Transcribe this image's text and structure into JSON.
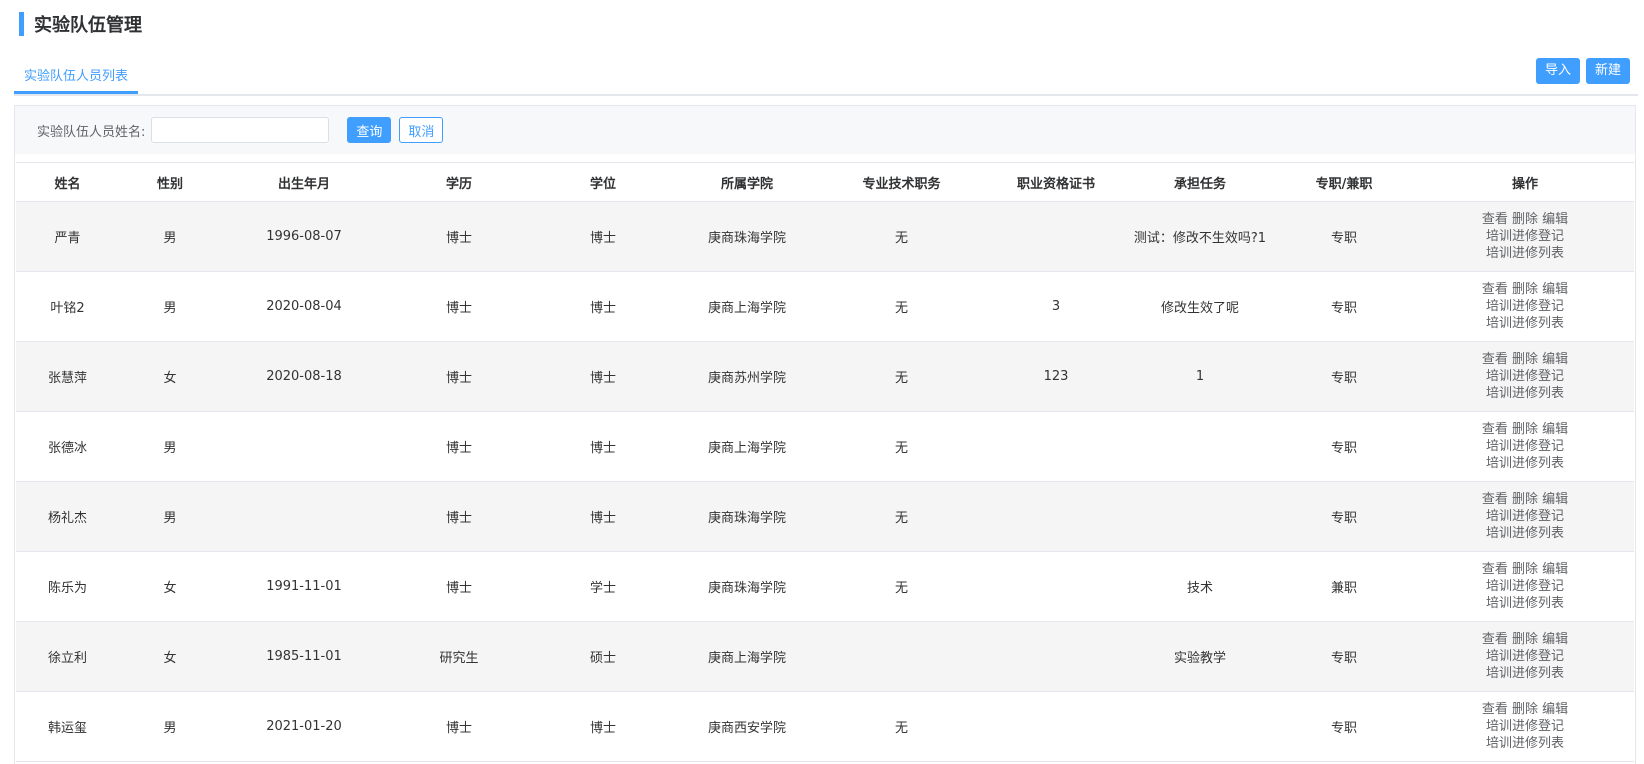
{
  "page": {
    "title": "实验队伍管理"
  },
  "tabs": [
    {
      "label": "实验队伍人员列表"
    }
  ],
  "toolbar": {
    "import_label": "导入",
    "new_label": "新建"
  },
  "search": {
    "label": "实验队伍人员姓名:",
    "value": "",
    "placeholder": "",
    "query_label": "查询",
    "cancel_label": "取消"
  },
  "table": {
    "columns": [
      "姓名",
      "性别",
      "出生年月",
      "学历",
      "学位",
      "所属学院",
      "专业技术职务",
      "职业资格证书",
      "承担任务",
      "专职/兼职",
      "操作"
    ],
    "actions": {
      "view": "查看",
      "delete": "删除",
      "edit": "编辑",
      "register": "培训进修登记",
      "list": "培训进修列表"
    },
    "rows": [
      {
        "name": "严青",
        "gender": "男",
        "birth": "1996-08-07",
        "education": "博士",
        "degree": "博士",
        "college": "庚商珠海学院",
        "title": "无",
        "cert": "",
        "task": "测试：修改不生效吗?1",
        "type": "专职"
      },
      {
        "name": "叶铭2",
        "gender": "男",
        "birth": "2020-08-04",
        "education": "博士",
        "degree": "博士",
        "college": "庚商上海学院",
        "title": "无",
        "cert": "3",
        "task": "修改生效了呢",
        "type": "专职"
      },
      {
        "name": "张慧萍",
        "gender": "女",
        "birth": "2020-08-18",
        "education": "博士",
        "degree": "博士",
        "college": "庚商苏州学院",
        "title": "无",
        "cert": "123",
        "task": "1",
        "type": "专职"
      },
      {
        "name": "张德冰",
        "gender": "男",
        "birth": "",
        "education": "博士",
        "degree": "博士",
        "college": "庚商上海学院",
        "title": "无",
        "cert": "",
        "task": "",
        "type": "专职"
      },
      {
        "name": "杨礼杰",
        "gender": "男",
        "birth": "",
        "education": "博士",
        "degree": "博士",
        "college": "庚商珠海学院",
        "title": "无",
        "cert": "",
        "task": "",
        "type": "专职"
      },
      {
        "name": "陈乐为",
        "gender": "女",
        "birth": "1991-11-01",
        "education": "博士",
        "degree": "学士",
        "college": "庚商珠海学院",
        "title": "无",
        "cert": "",
        "task": "技术",
        "type": "兼职"
      },
      {
        "name": "徐立利",
        "gender": "女",
        "birth": "1985-11-01",
        "education": "研究生",
        "degree": "硕士",
        "college": "庚商上海学院",
        "title": "",
        "cert": "",
        "task": "实验教学",
        "type": "专职"
      },
      {
        "name": "韩运玺",
        "gender": "男",
        "birth": "2021-01-20",
        "education": "博士",
        "degree": "博士",
        "college": "庚商西安学院",
        "title": "无",
        "cert": "",
        "task": "",
        "type": "专职"
      }
    ]
  },
  "colors": {
    "accent": "#409eff",
    "border": "#e4e7ed",
    "stripe": "#f5f5f5"
  }
}
